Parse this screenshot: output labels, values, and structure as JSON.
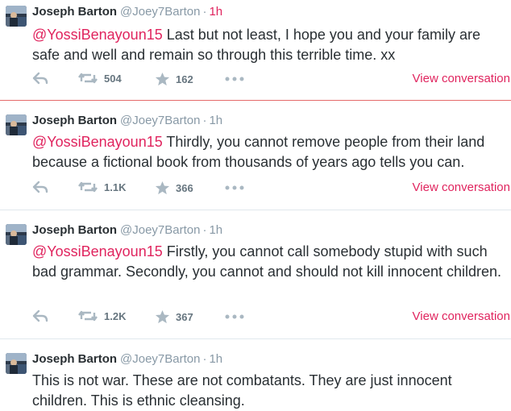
{
  "colors": {
    "accent": "#e0245e",
    "text": "#292f33",
    "muted": "#8899a6"
  },
  "tweets": [
    {
      "name": "Joseph Barton",
      "handle": "@Joey7Barton",
      "dot": "·",
      "time": "1h",
      "mention": "@YossiBenayoun15",
      "body": " Last but not least, I hope you and your family are safe and well and remain so through this terrible time. xx",
      "retweets": "504",
      "favorites": "162",
      "view": "View conversation"
    },
    {
      "name": "Joseph Barton",
      "handle": "@Joey7Barton",
      "dot": "·",
      "time": "1h",
      "mention": "@YossiBenayoun15",
      "body": " Thirdly, you cannot remove people from their land because a fictional book from thousands of years ago tells you can.",
      "retweets": "1.1K",
      "favorites": "366",
      "view": "View conversation"
    },
    {
      "name": "Joseph Barton",
      "handle": "@Joey7Barton",
      "dot": "·",
      "time": "1h",
      "mention": "@YossiBenayoun15",
      "body": " Firstly, you cannot call somebody stupid with such bad grammar. Secondly, you cannot and should not kill innocent children.",
      "retweets": "1.2K",
      "favorites": "367",
      "view": "View conversation"
    },
    {
      "name": "Joseph Barton",
      "handle": "@Joey7Barton",
      "dot": "·",
      "time": "1h",
      "mention": "",
      "body": "This is not war. These are not combatants. They are just innocent children. This is ethnic cleansing."
    }
  ]
}
